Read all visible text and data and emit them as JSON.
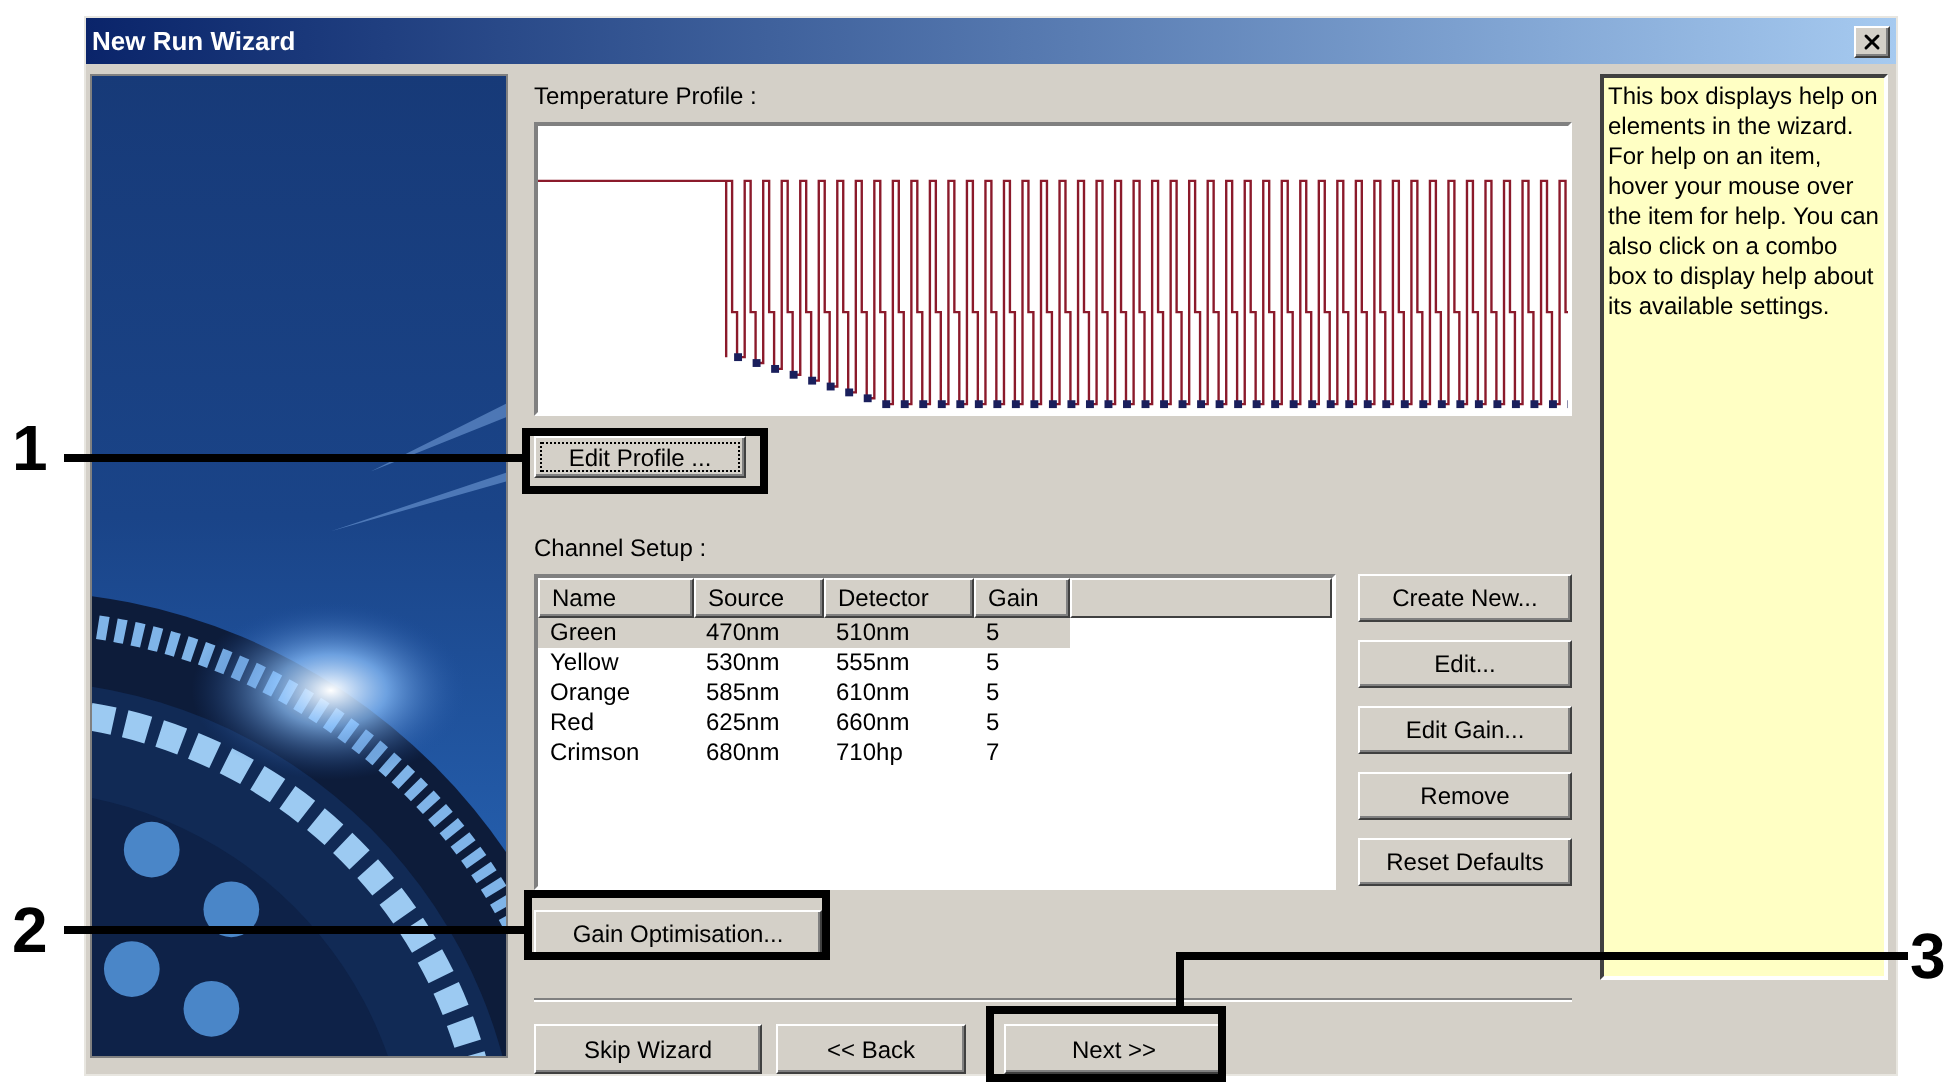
{
  "window": {
    "title": "New Run Wizard"
  },
  "temperature_profile": {
    "label": "Temperature Profile :",
    "edit_button": {
      "label": "Edit Profile ..."
    }
  },
  "channel_setup": {
    "label": "Channel Setup :",
    "columns": [
      "Name",
      "Source",
      "Detector",
      "Gain"
    ],
    "rows": [
      {
        "cells": [
          "Green",
          "470nm",
          "510nm",
          "5"
        ],
        "selected": true
      },
      {
        "cells": [
          "Yellow",
          "530nm",
          "555nm",
          "5"
        ],
        "selected": false
      },
      {
        "cells": [
          "Orange",
          "585nm",
          "610nm",
          "5"
        ],
        "selected": false
      },
      {
        "cells": [
          "Red",
          "625nm",
          "660nm",
          "5"
        ],
        "selected": false
      },
      {
        "cells": [
          "Crimson",
          "680nm",
          "710hp",
          "7"
        ],
        "selected": false
      }
    ],
    "buttons": [
      {
        "label": "Create New..."
      },
      {
        "label": "Edit..."
      },
      {
        "label": "Edit Gain..."
      },
      {
        "label": "Remove"
      },
      {
        "label": "Reset Defaults"
      }
    ]
  },
  "gain_optimisation": {
    "label": "Gain Optimisation..."
  },
  "help_text": "This box displays help on elements in the wizard. For help on an item, hover your mouse over the item for help. You can also click on a combo box to display help about its available settings.",
  "nav_buttons": [
    {
      "label": "Skip Wizard"
    },
    {
      "label": "<< Back"
    },
    {
      "label": "Next >>"
    }
  ],
  "callouts": [
    "1",
    "2",
    "3"
  ]
}
